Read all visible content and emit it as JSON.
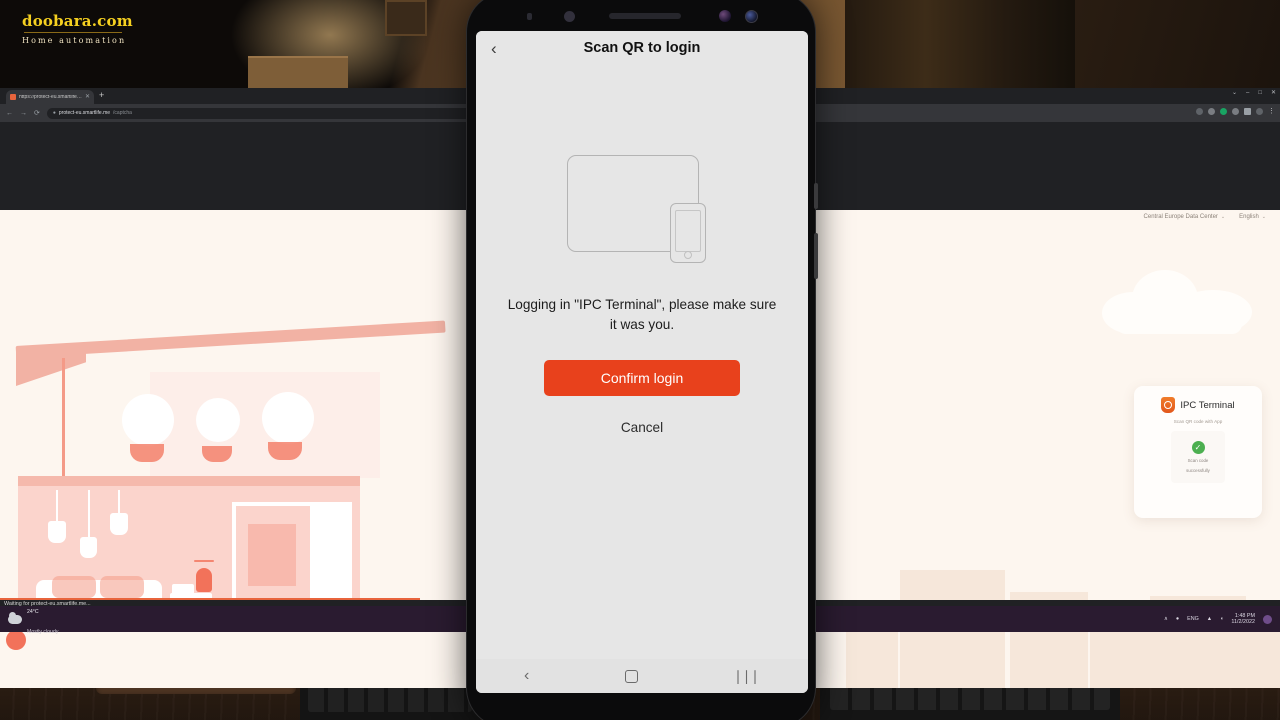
{
  "watermark": {
    "title": "doobara.com",
    "subtitle": "Home automation"
  },
  "browser": {
    "tab": {
      "title": "https://protect-eu.smartlife.me/",
      "close_label": "✕",
      "favicon": "site-favicon"
    },
    "new_tab_label": "+",
    "window_controls": {
      "minimize": "–",
      "maximize": "□",
      "close": "✕",
      "restore": "⌄"
    },
    "nav": {
      "back": "←",
      "forward": "→",
      "reload": "⟳"
    },
    "url": {
      "lock": "ὑ2",
      "domain": "protect-eu.smartlife.me",
      "path": "/captcha"
    },
    "ext_menu": "⋮"
  },
  "webpage": {
    "header": {
      "data_center": "Central Europe Data Center",
      "language": "English",
      "caret": "⌄"
    },
    "login_card": {
      "brand": "IPC Terminal",
      "subtitle": "Scan QR code with App",
      "check_glyph": "✓",
      "status_line1": "Scan code",
      "status_line2": "successfully"
    }
  },
  "status_bar": {
    "text": "Waiting for protect-eu.smartlife.me..."
  },
  "taskbar": {
    "weather": {
      "temp": "24°C",
      "desc": "Mostly cloudy"
    },
    "tray": {
      "overflow": "∧",
      "mic": "Ἲ4",
      "input_lang": "ENG",
      "network": "▲",
      "volume": "ὐa",
      "time": "1:48 PM",
      "date": "11/2/2022"
    }
  },
  "phone": {
    "app": {
      "header": {
        "back": "‹",
        "title": "Scan QR to login"
      },
      "message": "Logging in \"IPC Terminal\", please make sure it was you.",
      "confirm_label": "Confirm login",
      "cancel_label": "Cancel",
      "illustration": "tablet-and-phone-icon"
    },
    "navbar": {
      "back": "‹",
      "home": "home-square",
      "recents": "∣∣∣"
    }
  }
}
